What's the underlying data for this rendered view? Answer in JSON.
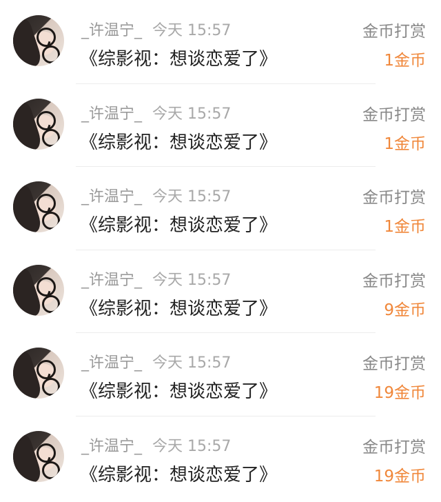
{
  "colors": {
    "accent": "#f0873a",
    "meta": "#a8a8a8",
    "title": "#222222"
  },
  "items": [
    {
      "avatar_icon": "user-avatar",
      "username": "_许温宁_",
      "time": "今天 15:57",
      "title": "《综影视：想谈恋爱了》",
      "reward_type": "金币打赏",
      "reward_amount": "1金币"
    },
    {
      "avatar_icon": "user-avatar",
      "username": "_许温宁_",
      "time": "今天 15:57",
      "title": "《综影视：想谈恋爱了》",
      "reward_type": "金币打赏",
      "reward_amount": "1金币"
    },
    {
      "avatar_icon": "user-avatar",
      "username": "_许温宁_",
      "time": "今天 15:57",
      "title": "《综影视：想谈恋爱了》",
      "reward_type": "金币打赏",
      "reward_amount": "1金币"
    },
    {
      "avatar_icon": "user-avatar",
      "username": "_许温宁_",
      "time": "今天 15:57",
      "title": "《综影视：想谈恋爱了》",
      "reward_type": "金币打赏",
      "reward_amount": "9金币"
    },
    {
      "avatar_icon": "user-avatar",
      "username": "_许温宁_",
      "time": "今天 15:57",
      "title": "《综影视：想谈恋爱了》",
      "reward_type": "金币打赏",
      "reward_amount": "19金币"
    },
    {
      "avatar_icon": "user-avatar",
      "username": "_许温宁_",
      "time": "今天 15:57",
      "title": "《综影视：想谈恋爱了》",
      "reward_type": "金币打赏",
      "reward_amount": "19金币"
    }
  ]
}
